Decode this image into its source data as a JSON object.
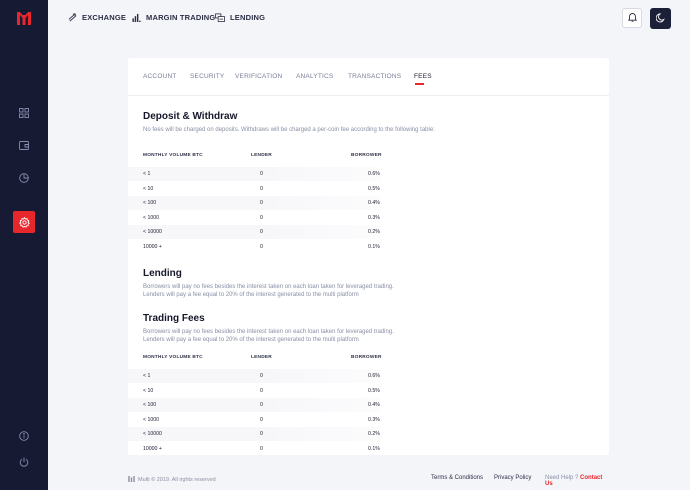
{
  "nav": {
    "exchange": "EXCHANGE",
    "margin_trading": "MARGIN TRADING",
    "lending": "LENDING"
  },
  "tabs": [
    {
      "label": "ACCOUNT"
    },
    {
      "label": "SECURITY"
    },
    {
      "label": "VERIFICATION"
    },
    {
      "label": "ANALYTICS"
    },
    {
      "label": "TRANSACTIONS"
    },
    {
      "label": "FEES"
    }
  ],
  "deposit": {
    "title": "Deposit & Withdraw",
    "description": "No fees will be charged on deposits. Withdraws will be charged a per-coin fee according to the following table:"
  },
  "table_headers": {
    "volume": "MONTHLY VOLUME BTC",
    "lender": "LENDER",
    "borrower": "BORROWER"
  },
  "deposit_rows": [
    {
      "volume": "< 1",
      "lender": "0",
      "borrower": "0.6%"
    },
    {
      "volume": "< 10",
      "lender": "0",
      "borrower": "0.5%"
    },
    {
      "volume": "< 100",
      "lender": "0",
      "borrower": "0.4%"
    },
    {
      "volume": "< 1000",
      "lender": "0",
      "borrower": "0.3%"
    },
    {
      "volume": "< 10000",
      "lender": "0",
      "borrower": "0.2%"
    },
    {
      "volume": "10000 +",
      "lender": "0",
      "borrower": "0.1%"
    }
  ],
  "lending": {
    "title": "Lending",
    "line1": "Borrowers will pay no fees besides the interest taken on each loan taken for leveraged trading.",
    "line2": "Lenders will pay a fee equal to 20% of the interest generated to the multi platform"
  },
  "trading": {
    "title": "Trading Fees",
    "line1": "Borrowers will pay no fees besides the interest taken on each loan taken for leveraged trading.",
    "line2": "Lenders will pay a fee equal to 20% of the interest generated to the multi platform"
  },
  "trading_rows": [
    {
      "volume": "< 1",
      "lender": "0",
      "borrower": "0.6%"
    },
    {
      "volume": "< 10",
      "lender": "0",
      "borrower": "0.5%"
    },
    {
      "volume": "< 100",
      "lender": "0",
      "borrower": "0.4%"
    },
    {
      "volume": "< 1000",
      "lender": "0",
      "borrower": "0.3%"
    },
    {
      "volume": "< 10000",
      "lender": "0",
      "borrower": "0.2%"
    },
    {
      "volume": "10000 +",
      "lender": "0",
      "borrower": "0.1%"
    }
  ],
  "footer": {
    "copyright": "Multi © 2019. All rights reserved",
    "terms": "Terms & Conditions",
    "privacy": "Privacy Policy",
    "help": "Need Help ?",
    "contact": "Contact Us"
  },
  "colors": {
    "accent": "#e8272d",
    "sidebar": "#161a33",
    "background": "#f4f5f8"
  },
  "icons": {
    "sidebar": [
      "logo-icon",
      "dashboard-icon",
      "wallet-icon",
      "chart-pie-icon",
      "settings-icon",
      "info-icon",
      "power-icon"
    ],
    "topbar": [
      "exchange-icon",
      "bar-chart-icon",
      "lending-icon",
      "bell-icon",
      "moon-icon"
    ]
  }
}
